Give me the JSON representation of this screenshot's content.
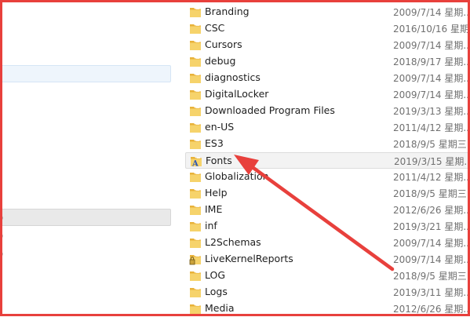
{
  "nav": {
    "paren_labels": [
      ")",
      ")",
      ")"
    ]
  },
  "files": [
    {
      "name": "Branding",
      "date": "2009/7/14 星期...",
      "icon": "folder-icon"
    },
    {
      "name": "CSC",
      "date": "2016/10/16 星期...",
      "icon": "folder-icon"
    },
    {
      "name": "Cursors",
      "date": "2009/7/14 星期...",
      "icon": "folder-icon"
    },
    {
      "name": "debug",
      "date": "2018/9/17 星期...",
      "icon": "folder-icon"
    },
    {
      "name": "diagnostics",
      "date": "2009/7/14 星期...",
      "icon": "folder-icon"
    },
    {
      "name": "DigitalLocker",
      "date": "2009/7/14 星期...",
      "icon": "folder-icon"
    },
    {
      "name": "Downloaded Program Files",
      "date": "2019/3/13 星期...",
      "icon": "folder-icon"
    },
    {
      "name": "en-US",
      "date": "2011/4/12 星期...",
      "icon": "folder-icon"
    },
    {
      "name": "ES3",
      "date": "2018/9/5 星期三...",
      "icon": "folder-icon"
    },
    {
      "name": "Fonts",
      "date": "2019/3/15 星期...",
      "icon": "fonts-folder-icon"
    },
    {
      "name": "Globalization",
      "date": "2011/4/12 星期...",
      "icon": "folder-icon"
    },
    {
      "name": "Help",
      "date": "2018/9/5 星期三...",
      "icon": "folder-icon"
    },
    {
      "name": "IME",
      "date": "2012/6/26 星期...",
      "icon": "folder-icon"
    },
    {
      "name": "inf",
      "date": "2019/3/21 星期...",
      "icon": "folder-icon"
    },
    {
      "name": "L2Schemas",
      "date": "2009/7/14 星期...",
      "icon": "folder-icon"
    },
    {
      "name": "LiveKernelReports",
      "date": "2009/7/14 星期...",
      "icon": "locked-folder-icon"
    },
    {
      "name": "LOG",
      "date": "2018/9/5 星期三...",
      "icon": "folder-icon"
    },
    {
      "name": "Logs",
      "date": "2019/3/11 星期...",
      "icon": "folder-icon"
    },
    {
      "name": "Media",
      "date": "2012/6/26 星期...",
      "icon": "folder-icon"
    }
  ],
  "colors": {
    "annotation": "#e8403c",
    "folder": "#f0c24f"
  }
}
